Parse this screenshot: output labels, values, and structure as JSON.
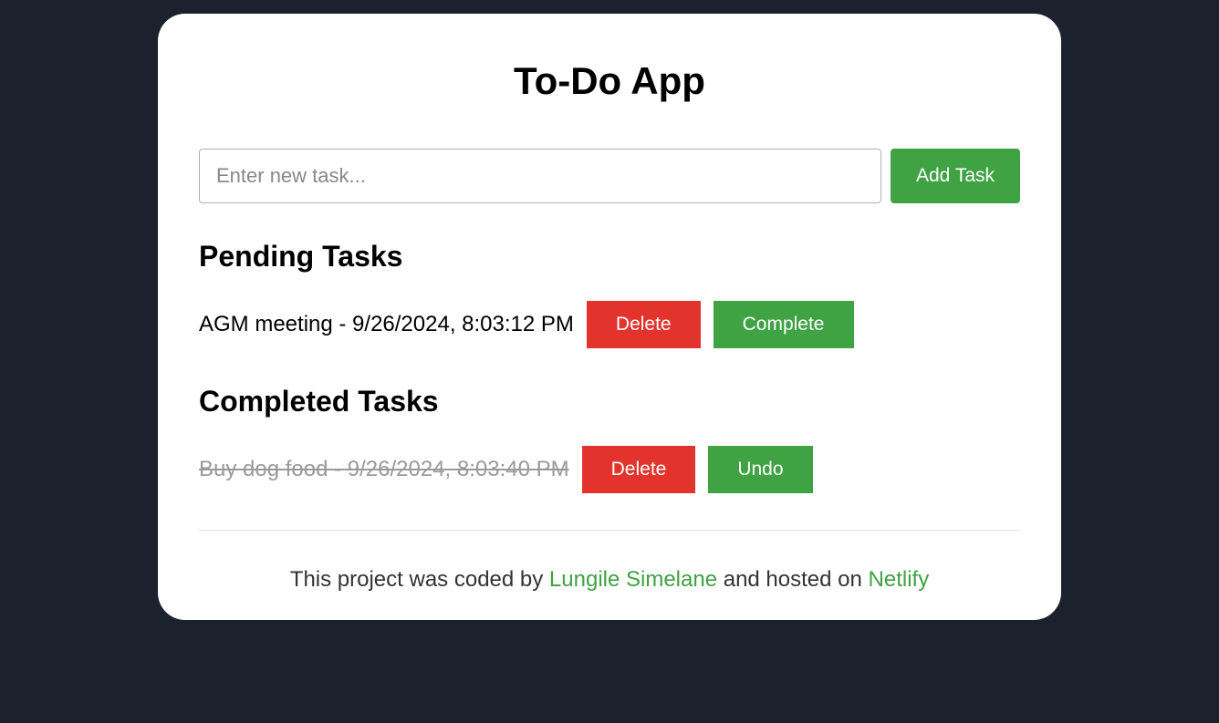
{
  "title": "To-Do App",
  "input": {
    "placeholder": "Enter new task...",
    "value": ""
  },
  "addButton": "Add Task",
  "sections": {
    "pending": {
      "heading": "Pending Tasks",
      "tasks": [
        {
          "text": "AGM meeting - 9/26/2024, 8:03:12 PM",
          "deleteLabel": "Delete",
          "actionLabel": "Complete"
        }
      ]
    },
    "completed": {
      "heading": "Completed Tasks",
      "tasks": [
        {
          "text": "Buy dog food - 9/26/2024, 8:03:40 PM",
          "deleteLabel": "Delete",
          "actionLabel": "Undo"
        }
      ]
    }
  },
  "footer": {
    "prefix": "This project was coded by ",
    "authorName": "Lungile Simelane",
    "middle": " and hosted on ",
    "hostName": "Netlify"
  }
}
